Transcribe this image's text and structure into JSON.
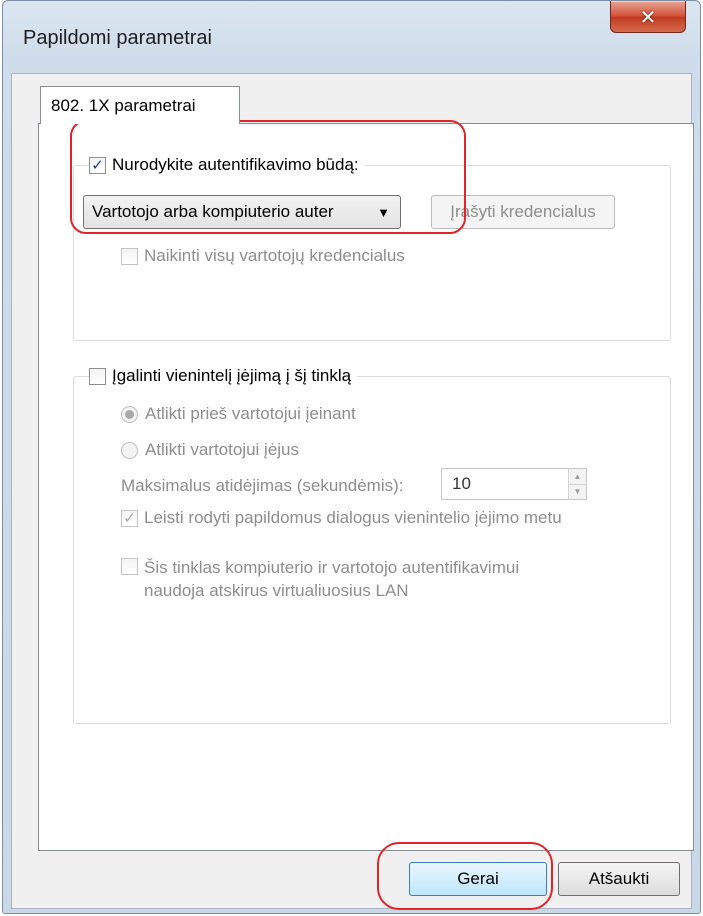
{
  "window": {
    "title": "Papildomi parametrai",
    "close_glyph": "✕"
  },
  "tab": {
    "label": "802. 1X parametrai"
  },
  "auth_group": {
    "checkbox_label": "Nurodykite autentifikavimo būdą:",
    "checked": true,
    "mode_selected": "Vartotojo arba kompiuterio auter",
    "save_credentials_button": "Įrašyti kredencialus",
    "delete_credentials_label": "Naikinti visų vartotojų kredencialus"
  },
  "sso_group": {
    "checkbox_label": "Įgalinti vienintelį įėjimą į šį tinklą",
    "checked": false,
    "radio_before": "Atlikti prieš vartotojui įeinant",
    "radio_after": "Atlikti vartotojui įėjus",
    "max_delay_label": "Maksimalus atidėjimas (sekundėmis):",
    "max_delay_value": "10",
    "allow_dialogs_label": "Leisti rodyti papildomus dialogus vienintelio įėjimo metu",
    "vlan_label_line1": "Šis tinklas kompiuterio ir vartotojo autentifikavimui",
    "vlan_label_line2": "naudoja atskirus virtualiuosius LAN"
  },
  "buttons": {
    "ok": "Gerai",
    "cancel": "Atšaukti"
  },
  "icons": {
    "check": "✓",
    "dropdown_arrow": "▼",
    "spin_up": "▲",
    "spin_down": "▼"
  },
  "colors": {
    "highlight": "#e0242a",
    "close_button": "#c23b1f",
    "disabled_text": "#8d8d8d"
  }
}
